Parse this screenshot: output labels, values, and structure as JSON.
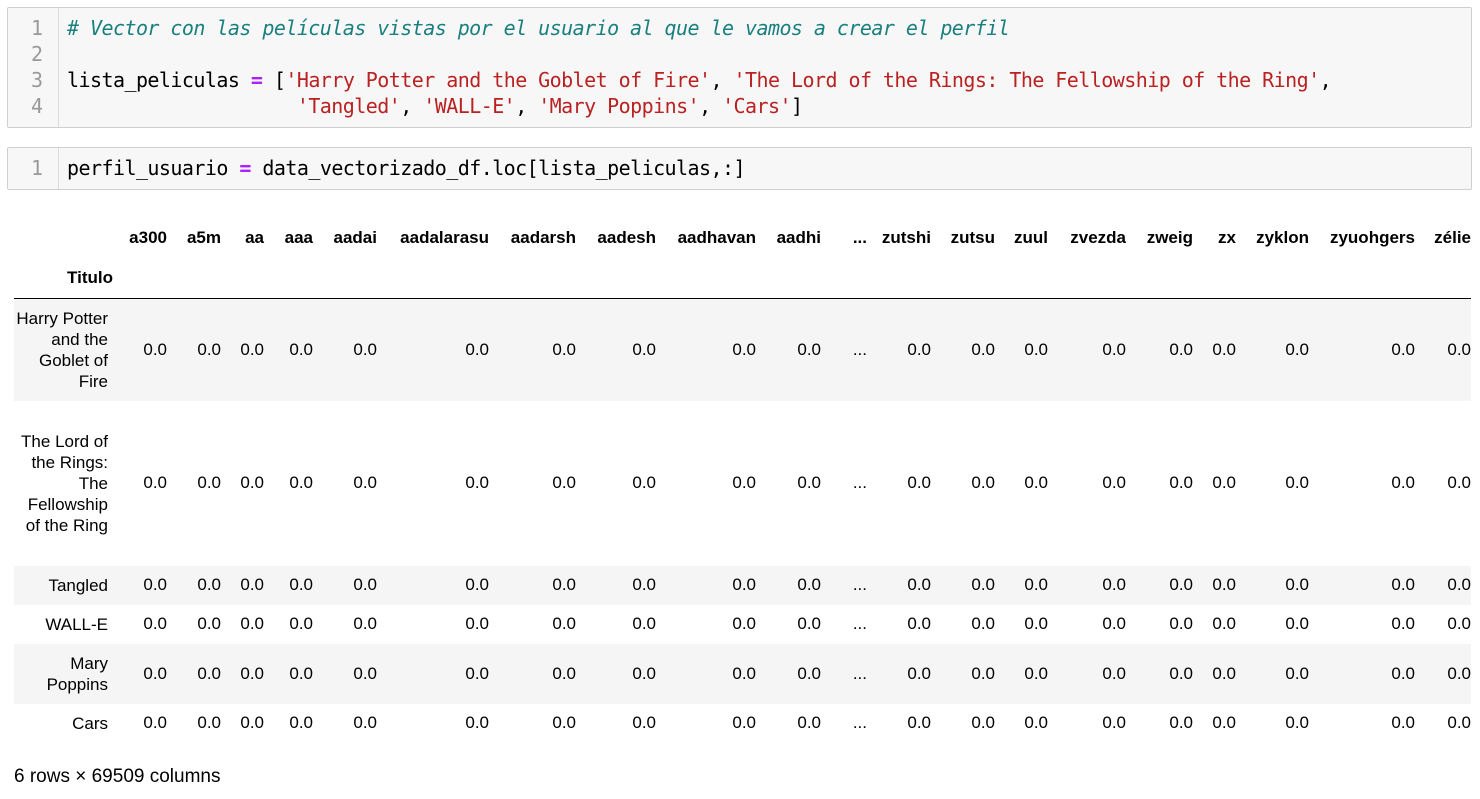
{
  "cell1": {
    "line_numbers": [
      "1",
      "2",
      "3",
      "4"
    ],
    "comment": "# Vector con las películas vistas por el usuario al que le vamos a crear el perfil",
    "var_name": "lista_peliculas",
    "op": "=",
    "open_bracket": "[",
    "movies": [
      "'Harry Potter and the Goblet of Fire'",
      "'The Lord of the Rings: The Fellowship of the Ring'",
      "'Tangled'",
      "'WALL-E'",
      "'Mary Poppins'",
      "'Cars'"
    ],
    "comma": ",",
    "close_bracket": "]",
    "indent": "                    "
  },
  "cell2": {
    "line_numbers": [
      "1"
    ],
    "var_name": "perfil_usuario",
    "op": "=",
    "expr": "data_vectorizado_df.loc[lista_peliculas,:]"
  },
  "table": {
    "index_name": "Titulo",
    "columns": [
      "a300",
      "a5m",
      "aa",
      "aaa",
      "aadai",
      "aadalarasu",
      "aadarsh",
      "aadesh",
      "aadhavan",
      "aadhi",
      "...",
      "zutshi",
      "zutsu",
      "zuul",
      "zvezda",
      "zweig",
      "zx",
      "zyklon",
      "zyuohgers",
      "zélie"
    ],
    "rows": [
      {
        "label": "Harry Potter and the Goblet of Fire",
        "values": [
          "0.0",
          "0.0",
          "0.0",
          "0.0",
          "0.0",
          "0.0",
          "0.0",
          "0.0",
          "0.0",
          "0.0",
          "...",
          "0.0",
          "0.0",
          "0.0",
          "0.0",
          "0.0",
          "0.0",
          "0.0",
          "0.0",
          "0.0"
        ]
      },
      {
        "label": "The Lord of the Rings: The Fellowship of the Ring",
        "values": [
          "0.0",
          "0.0",
          "0.0",
          "0.0",
          "0.0",
          "0.0",
          "0.0",
          "0.0",
          "0.0",
          "0.0",
          "...",
          "0.0",
          "0.0",
          "0.0",
          "0.0",
          "0.0",
          "0.0",
          "0.0",
          "0.0",
          "0.0"
        ]
      },
      {
        "label": "Tangled",
        "values": [
          "0.0",
          "0.0",
          "0.0",
          "0.0",
          "0.0",
          "0.0",
          "0.0",
          "0.0",
          "0.0",
          "0.0",
          "...",
          "0.0",
          "0.0",
          "0.0",
          "0.0",
          "0.0",
          "0.0",
          "0.0",
          "0.0",
          "0.0"
        ]
      },
      {
        "label": "WALL-E",
        "values": [
          "0.0",
          "0.0",
          "0.0",
          "0.0",
          "0.0",
          "0.0",
          "0.0",
          "0.0",
          "0.0",
          "0.0",
          "...",
          "0.0",
          "0.0",
          "0.0",
          "0.0",
          "0.0",
          "0.0",
          "0.0",
          "0.0",
          "0.0"
        ]
      },
      {
        "label": "Mary Poppins",
        "values": [
          "0.0",
          "0.0",
          "0.0",
          "0.0",
          "0.0",
          "0.0",
          "0.0",
          "0.0",
          "0.0",
          "0.0",
          "...",
          "0.0",
          "0.0",
          "0.0",
          "0.0",
          "0.0",
          "0.0",
          "0.0",
          "0.0",
          "0.0"
        ]
      },
      {
        "label": "Cars",
        "values": [
          "0.0",
          "0.0",
          "0.0",
          "0.0",
          "0.0",
          "0.0",
          "0.0",
          "0.0",
          "0.0",
          "0.0",
          "...",
          "0.0",
          "0.0",
          "0.0",
          "0.0",
          "0.0",
          "0.0",
          "0.0",
          "0.0",
          "0.0"
        ]
      }
    ],
    "summary": "6 rows × 69509 columns"
  },
  "colors": {
    "comment": "#1a7f7f",
    "operator": "#aa22ff",
    "string": "#ba2121",
    "cell_bg": "#f7f7f7"
  }
}
